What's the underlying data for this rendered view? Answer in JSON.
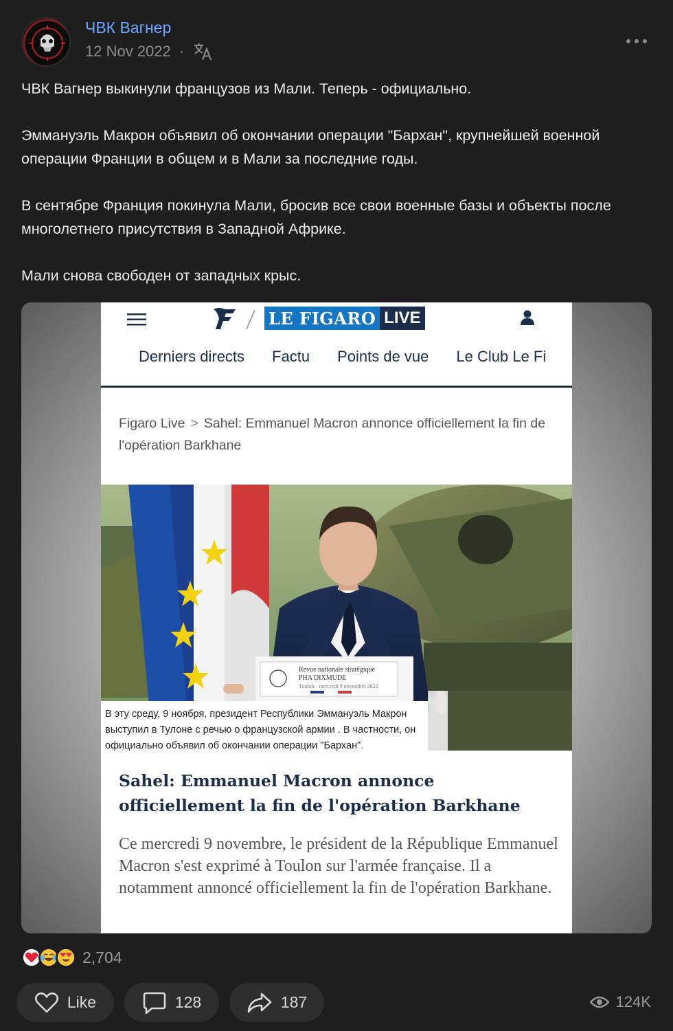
{
  "post": {
    "channel_name": "ЧВК Вагнер",
    "date": "12 Nov 2022",
    "meta_separator": "·",
    "avatar_text_top": "PMC Wagner Group",
    "avatar_text_bottom": "Группа Вагнера",
    "paragraphs": [
      "ЧВК Вагнер выкинули французов из Мали. Теперь - официально.",
      "Эммануэль Макрон объявил об окончании операции \"Бархан\", крупнейшей военной операции Франции в общем и в Мали за последние годы.",
      "В сентябре Франция покинула Мали, бросив все свои военные базы и объекты после многолетнего присутствия в Западной Африке.",
      "Мали снова свободен от западных крыс."
    ]
  },
  "article": {
    "logo_text": "LE FIGARO",
    "logo_live": "LIVE",
    "nav": [
      "Derniers directs",
      "Factu",
      "Points de vue",
      "Le Club Le Fi"
    ],
    "breadcrumb_root": "Figaro Live",
    "breadcrumb_sep": ">",
    "breadcrumb_current": "Sahel: Emmanuel Macron annonce officiellement la fin de l'opération Barkhane",
    "podium_line1": "Revue nationale stratégique",
    "podium_line2": "PHA DIXMUDE",
    "podium_line3": "Toulon · mercredi 9 novembre 2022",
    "caption": "В эту среду, 9 ноября, президент Республики Эммануэль Макрон выступил в Тулоне с речью о французской армии . В частности, он официально объявил об окончании операции  \"Бархан\".",
    "headline": "Sahel: Emmanuel Macron annonce officiellement la fin de l'opération Barkhane",
    "lede": "Ce mercredi 9 novembre, le président de la République Emmanuel Macron s'est exprimé à Toulon sur l'armée française. Il a notamment annoncé officiellement la fin de l'opération Barkhane."
  },
  "reactions": {
    "emojis": [
      "heart-emoji",
      "laughing-crying-emoji",
      "heart-eyes-emoji"
    ],
    "count": "2,704"
  },
  "actions": {
    "like_label": "Like",
    "comments_count": "128",
    "shares_count": "187",
    "views_count": "124K"
  },
  "colors": {
    "background": "#1e1e1f",
    "channel_link": "#6ea8ff",
    "button_bg": "#2e2e30",
    "figaro_blue": "#1577c3",
    "figaro_navy": "#1a2d4a"
  }
}
